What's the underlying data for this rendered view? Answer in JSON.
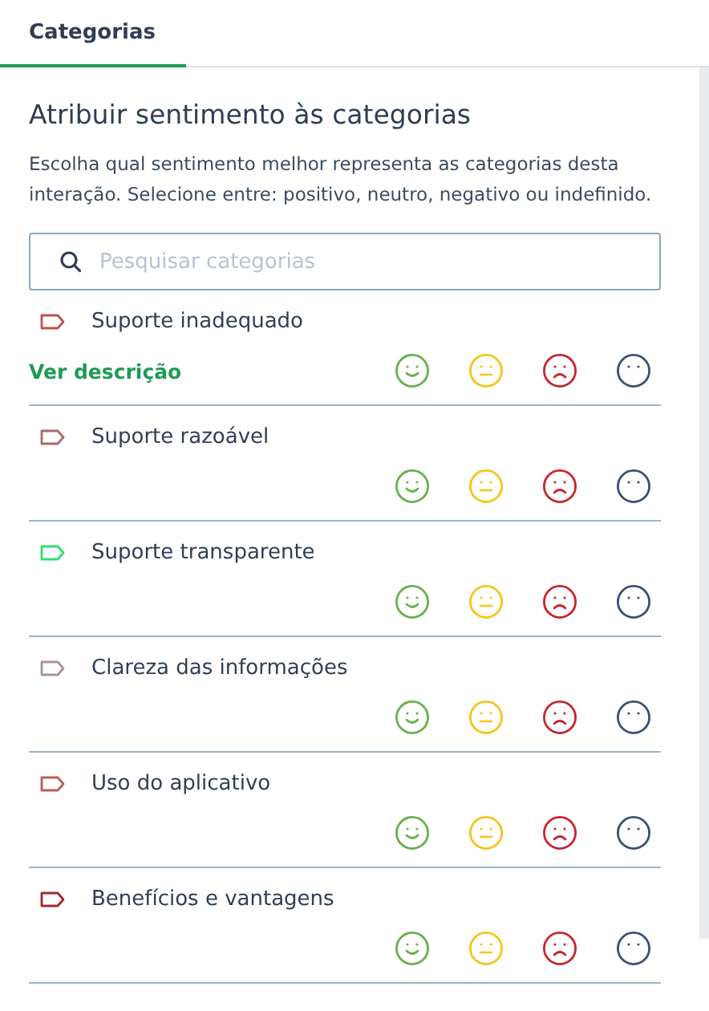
{
  "tabs": [
    {
      "label": "Categorias",
      "selected": true
    }
  ],
  "heading": "Atribuir sentimento às categorias",
  "description": "Escolha qual sentimento melhor representa as categorias desta interação. Selecione entre: positivo, neutro, negativo ou indefinido.",
  "search": {
    "placeholder": "Pesquisar categorias"
  },
  "categories": [
    {
      "name": "Suporte inadequado",
      "color": "#c0504d",
      "link": "Ver descrição"
    },
    {
      "name": "Suporte razoável",
      "color": "#a86b6b"
    },
    {
      "name": "Suporte transparente",
      "color": "#2ee071"
    },
    {
      "name": "Clareza das informações",
      "color": "#a89494"
    },
    {
      "name": "Uso do aplicativo",
      "color": "#c05a5a"
    },
    {
      "name": "Benefícios e vantagens",
      "color": "#a3282c"
    }
  ]
}
